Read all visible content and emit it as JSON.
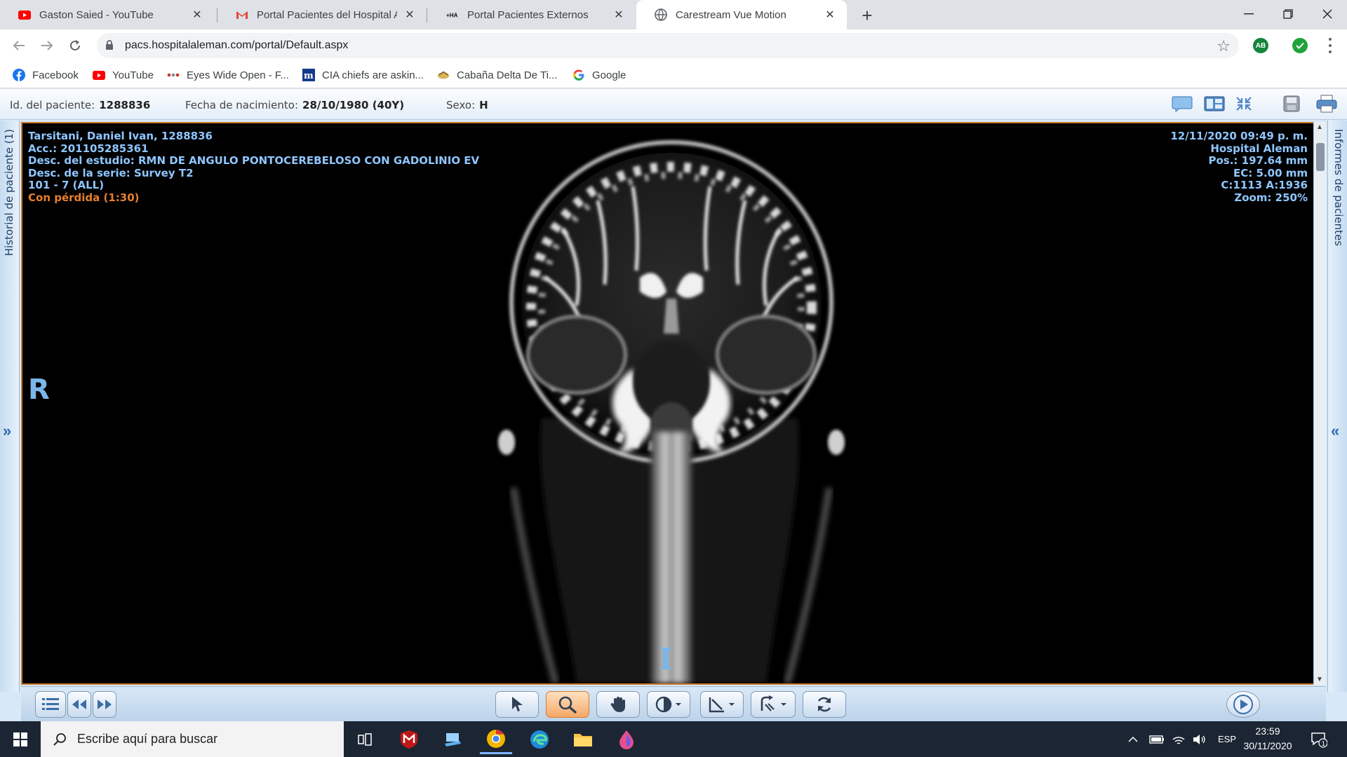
{
  "browser": {
    "tabs": [
      {
        "title": "Gaston Saied - YouTube",
        "icon": "youtube-icon"
      },
      {
        "title": "Portal Pacientes del Hospital Alem",
        "icon": "gmail-icon"
      },
      {
        "title": "Portal Pacientes Externos",
        "icon": "ha-icon"
      },
      {
        "title": "Carestream Vue Motion",
        "icon": "globe-icon",
        "active": true
      }
    ],
    "url": "pacs.hospitalaleman.com/portal/Default.aspx",
    "extensions": {
      "adblock": "AB"
    },
    "bookmarks": [
      {
        "label": "Facebook",
        "icon": "facebook-icon"
      },
      {
        "label": "YouTube",
        "icon": "youtube-icon"
      },
      {
        "label": "Eyes Wide Open - F...",
        "icon": "dots-icon"
      },
      {
        "label": "CIA chiefs are askin...",
        "icon": "m-icon"
      },
      {
        "label": "Cabaña Delta De Ti...",
        "icon": "cabin-icon"
      },
      {
        "label": "Google",
        "icon": "google-icon"
      }
    ]
  },
  "patient": {
    "id_label": "Id. del paciente:",
    "id_value": "1288836",
    "dob_label": "Fecha de nacimiento:",
    "dob_value": "28/10/1980 (40Y)",
    "sex_label": "Sexo:",
    "sex_value": "H"
  },
  "sidebars": {
    "left": "Historial de paciente (1)",
    "right": "Informes de pacientes",
    "left_arrow": "»",
    "right_arrow": "«"
  },
  "overlay": {
    "top_left": [
      "Tarsitani, Daniel Ivan, 1288836",
      "Acc.: 201105285361",
      "Desc. del estudio: RMN DE ANGULO PONTOCEREBELOSO CON GADOLINIO EV",
      "Desc. de la serie: Survey T2",
      "101 - 7 (ALL)"
    ],
    "compression": "Con pérdida (1:30)",
    "top_right": [
      "12/11/2020 09:49 p. m.",
      "Hospital Aleman",
      "Pos.: 197.64 mm",
      "EC: 5.00 mm",
      "C:1113 A:1936",
      "Zoom: 250%"
    ],
    "orientation_left": "R",
    "orientation_bottom": "I"
  },
  "colors": {
    "viewer_border": "#c87a2a",
    "overlay_text": "#8fc6ff",
    "overlay_warning": "#e87f2e",
    "active_tool": "#f5a867"
  },
  "taskbar": {
    "search_placeholder": "Escribe aquí para buscar",
    "language": "ESP",
    "time": "23:59",
    "date": "30/11/2020",
    "notifications": "1"
  }
}
